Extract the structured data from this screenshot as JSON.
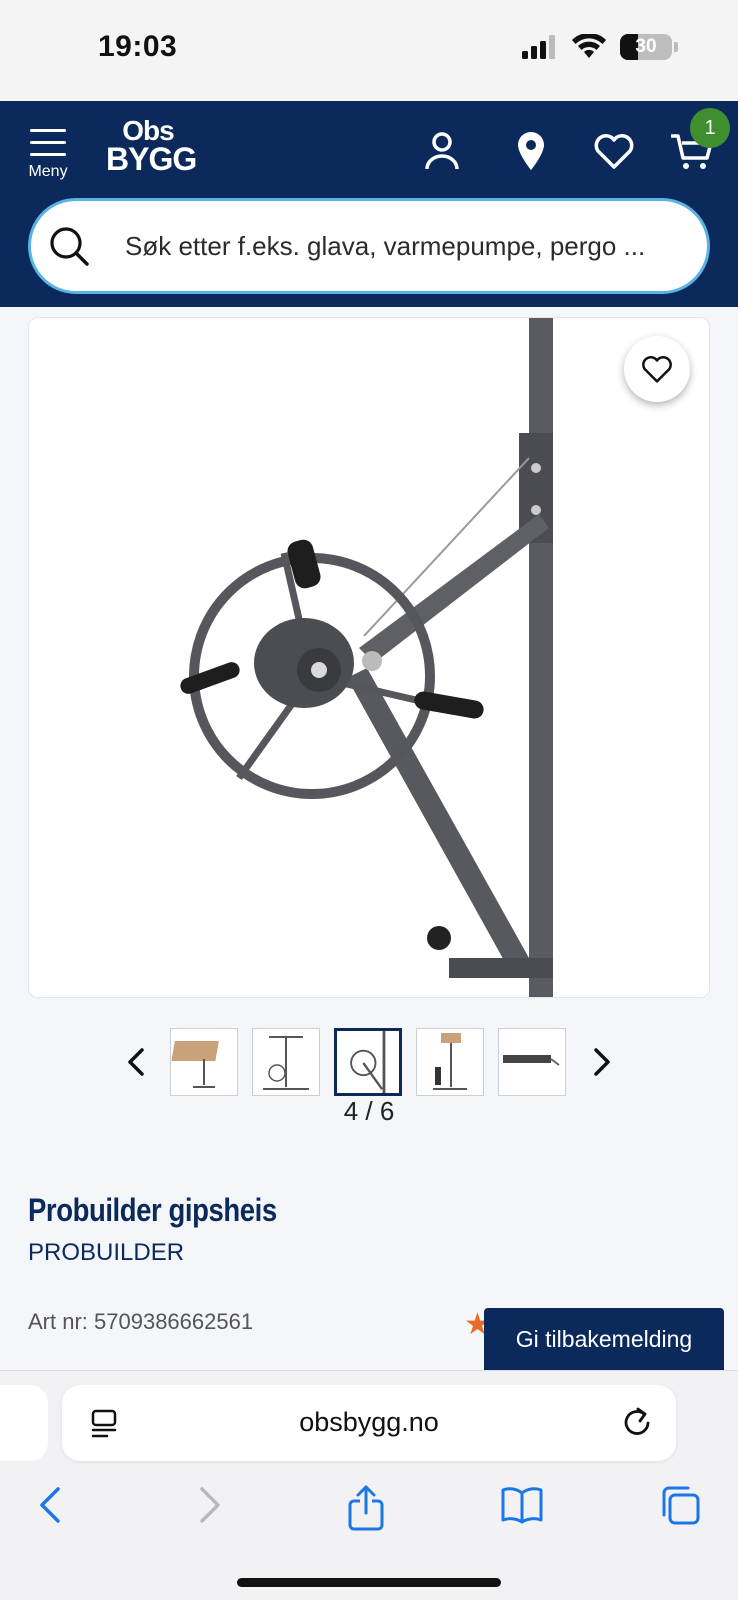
{
  "status": {
    "time": "19:03",
    "battery": "30"
  },
  "header": {
    "menu_label": "Meny",
    "logo_top": "Obs",
    "logo_bottom": "BYGG",
    "cart_count": "1",
    "search_placeholder": "Søk etter f.eks. glava, varmepumpe, pergo ..."
  },
  "gallery": {
    "counter": "4 / 6",
    "current": 4,
    "total": 6
  },
  "product": {
    "title": "Probuilder gipsheis",
    "brand": "PROBUILDER",
    "art_nr": "Art nr: 5709386662561"
  },
  "feedback": {
    "label": "Gi tilbakemelding"
  },
  "browser": {
    "url": "obsbygg.no"
  },
  "colors": {
    "navy": "#0b2a5b",
    "badge_green": "#3f8f2f",
    "search_border": "#5ab3e6",
    "accent_orange": "#e96b2a"
  }
}
